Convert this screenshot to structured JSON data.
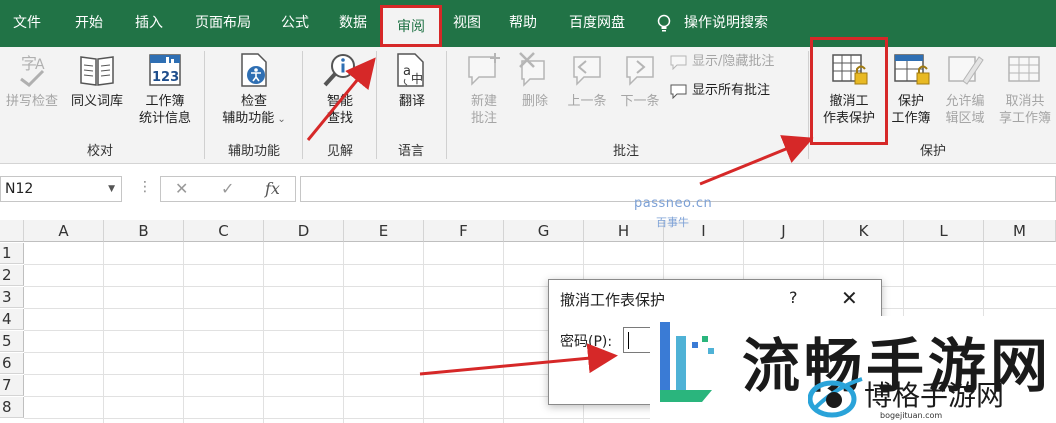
{
  "tabs": [
    "文件",
    "开始",
    "插入",
    "页面布局",
    "公式",
    "数据",
    "审阅",
    "视图",
    "帮助",
    "百度网盘"
  ],
  "tell_me": "操作说明搜索",
  "ribbon": {
    "proofing": {
      "spell": "拼写检查",
      "thesaurus": "同义词库",
      "stats_line1": "工作簿",
      "stats_line2": "统计信息",
      "label": "校对"
    },
    "accessibility": {
      "check_line1": "检查",
      "check_line2": "辅助功能",
      "label": "辅助功能"
    },
    "insights": {
      "smart_line1": "智能",
      "smart_line2": "查找",
      "label": "见解"
    },
    "language": {
      "translate": "翻译",
      "label": "语言"
    },
    "comments": {
      "new_line1": "新建",
      "new_line2": "批注",
      "delete": "删除",
      "prev": "上一条",
      "next": "下一条",
      "show_hide": "显示/隐藏批注",
      "show_all": "显示所有批注",
      "label": "批注"
    },
    "protect": {
      "unprotect_line1": "撤消工",
      "unprotect_line2": "作表保护",
      "protect_wb_line1": "保护",
      "protect_wb_line2": "工作簿",
      "allow_line1": "允许编",
      "allow_line2": "辑区域",
      "unshare_line1": "取消共",
      "unshare_line2": "享工作簿",
      "label": "保护"
    }
  },
  "formula_bar": {
    "name_box": "N12",
    "cancel": "✕",
    "enter": "✓",
    "fx": "fx"
  },
  "columns": [
    "A",
    "B",
    "C",
    "D",
    "E",
    "F",
    "G",
    "H",
    "I",
    "J",
    "K",
    "L",
    "M"
  ],
  "rows": [
    "1",
    "2",
    "3",
    "4",
    "5",
    "6",
    "7",
    "8"
  ],
  "watermark": {
    "site": "passneo.cn",
    "name": "百事牛"
  },
  "dialog": {
    "title": "撤消工作表保护",
    "help": "?",
    "close": "✕",
    "password_label": "密码(P):"
  },
  "brand": {
    "big": "流畅手游网",
    "name": "博格手游网",
    "domain": "bogejituan.com"
  },
  "colors": {
    "excel_green": "#217346",
    "highlight_red": "#d62828"
  }
}
